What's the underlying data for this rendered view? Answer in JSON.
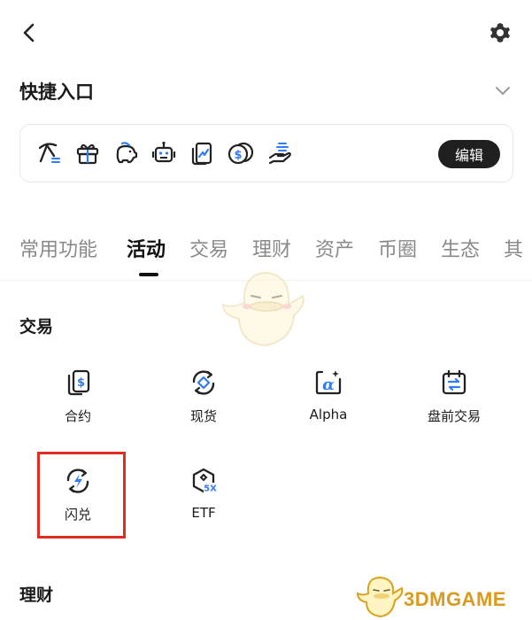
{
  "quick_access": {
    "title": "快捷入口",
    "edit_label": "编辑",
    "icons": [
      "pickaxe-icon",
      "gift-icon",
      "piggy-bank-icon",
      "robot-icon",
      "trend-card-icon",
      "coins-icon",
      "hand-coin-icon"
    ]
  },
  "tabs": [
    "常用功能",
    "活动",
    "交易",
    "理财",
    "资产",
    "币圈",
    "生态",
    "其"
  ],
  "active_tab": "活动",
  "trade_section": {
    "title": "交易",
    "items": [
      {
        "label": "合约",
        "icon": "contract-dollar-icon"
      },
      {
        "label": "现货",
        "icon": "spot-cycle-icon"
      },
      {
        "label": "Alpha",
        "icon": "alpha-icon"
      },
      {
        "label": "盘前交易",
        "icon": "premarket-calendar-icon"
      },
      {
        "label": "闪兑",
        "icon": "flash-swap-icon"
      },
      {
        "label": "ETF",
        "icon": "etf-5x-icon"
      }
    ]
  },
  "finance_section": {
    "title": "理财"
  },
  "watermark": {
    "text": "3DMGAME"
  },
  "colors": {
    "highlight": "#e02c23",
    "accent_dark": "#1f1f1f",
    "tab_inactive": "#8a8a8a"
  }
}
